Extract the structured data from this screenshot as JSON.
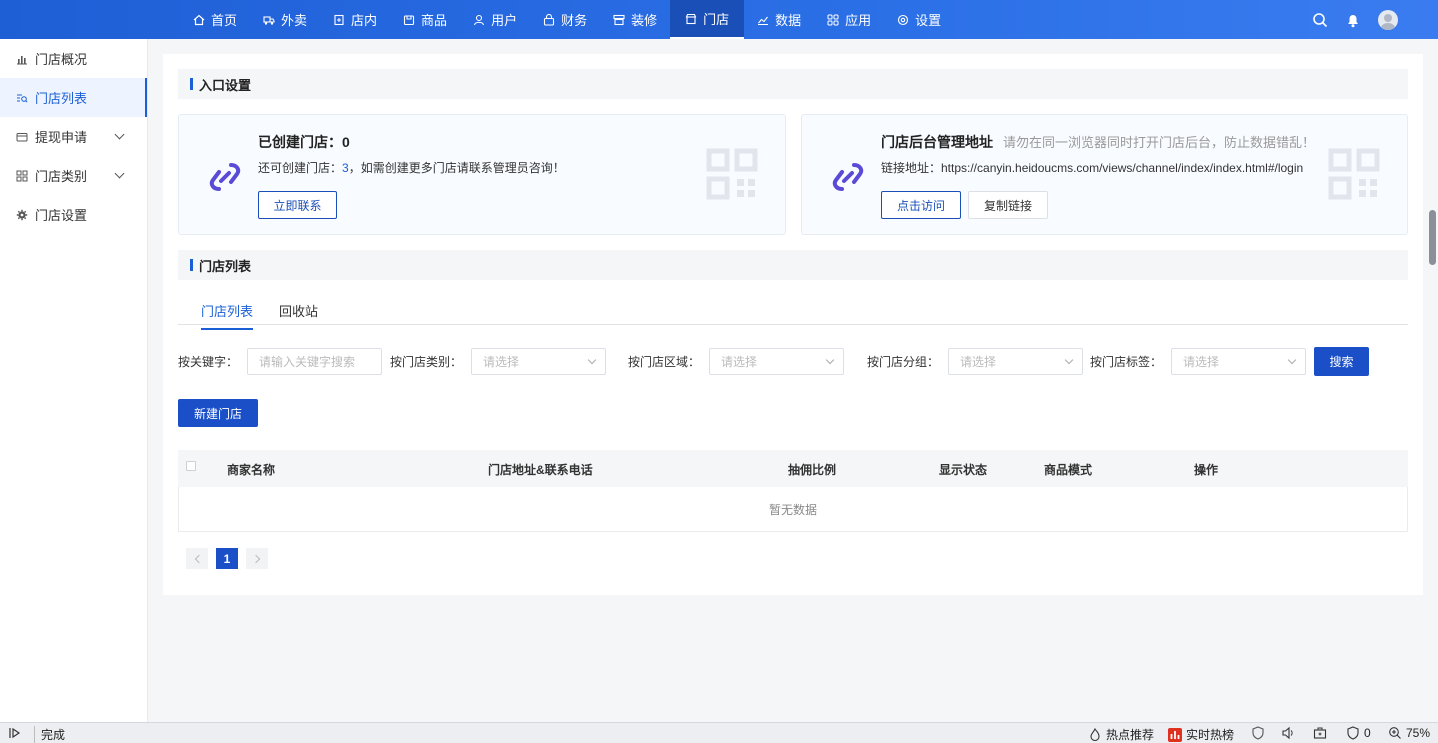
{
  "topnav": {
    "items": [
      {
        "label": "首页",
        "icon": "home-icon"
      },
      {
        "label": "外卖",
        "icon": "delivery-icon"
      },
      {
        "label": "店内",
        "icon": "store-in-icon"
      },
      {
        "label": "商品",
        "icon": "goods-icon"
      },
      {
        "label": "用户",
        "icon": "user-icon"
      },
      {
        "label": "财务",
        "icon": "finance-icon"
      },
      {
        "label": "装修",
        "icon": "decorate-icon"
      },
      {
        "label": "门店",
        "icon": "shop-icon",
        "active": true
      },
      {
        "label": "数据",
        "icon": "chart-icon"
      },
      {
        "label": "应用",
        "icon": "apps-icon"
      },
      {
        "label": "设置",
        "icon": "settings-icon"
      }
    ]
  },
  "sidebar": {
    "items": [
      {
        "label": "门店概况",
        "icon": "bar-chart-icon"
      },
      {
        "label": "门店列表",
        "icon": "list-search-icon",
        "active": true
      },
      {
        "label": "提现申请",
        "icon": "withdraw-icon",
        "expandable": true
      },
      {
        "label": "门店类别",
        "icon": "grid-icon",
        "expandable": true
      },
      {
        "label": "门店设置",
        "icon": "gear-icon"
      }
    ]
  },
  "entry": {
    "section_title": "入口设置",
    "card1": {
      "title": "已创建门店：0",
      "desc_prefix": "还可创建门店：",
      "desc_num": "3",
      "desc_suffix": "，如需创建更多门店请联系管理员咨询！",
      "button": "立即联系"
    },
    "card2": {
      "title": "门店后台管理地址",
      "note": "请勿在同一浏览器同时打开门店后台，防止数据错乱！",
      "link_label": "链接地址：https://canyin.heidoucms.com/views/channel/index/index.html#/login",
      "visit_button": "点击访问",
      "copy_button": "复制链接"
    }
  },
  "list": {
    "section_title": "门店列表",
    "tabs": [
      "门店列表",
      "回收站"
    ],
    "filters": {
      "keyword_label": "按关键字：",
      "keyword_placeholder": "请输入关键字搜索",
      "category_label": "按门店类别：",
      "region_label": "按门店区域：",
      "group_label": "按门店分组：",
      "tag_label": "按门店标签：",
      "select_placeholder": "请选择",
      "search_button": "搜索"
    },
    "new_button": "新建门店",
    "columns": [
      "商家名称",
      "门店地址&联系电话",
      "抽佣比例",
      "显示状态",
      "商品模式",
      "操作"
    ],
    "empty_text": "暂无数据",
    "pagination": {
      "current": "1"
    }
  },
  "statusbar": {
    "status": "完成",
    "hot_recommend": "热点推荐",
    "realtime_hot": "实时热榜",
    "count": "0",
    "zoom": "75%"
  },
  "colors": {
    "primary": "#1a4fc8",
    "accent": "#1a5fd6",
    "nav": "#2b6fe6"
  }
}
